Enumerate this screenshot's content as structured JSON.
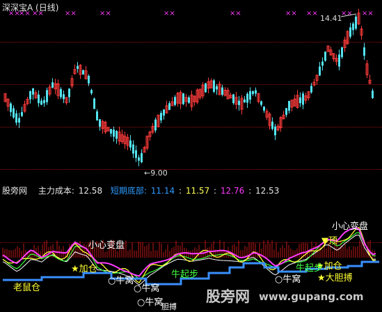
{
  "header": {
    "title": "深深宝A",
    "period": "(日线)"
  },
  "price_annotations": {
    "high": "14.41",
    "low": "9.00"
  },
  "indicator": {
    "name": "股旁网",
    "main_cost_label": "主力成本:",
    "main_cost_value": "12.58",
    "short_bottom_label": "短期底部:",
    "v1": "11.14",
    "v2": "11.57",
    "v3": "12.76",
    "v4": "12.53"
  },
  "signals": {
    "careful_change": "小心变盘",
    "careful_change_2": "小心变盘",
    "add_position": "加仓",
    "add_position_2": "加仓",
    "top": "顶",
    "bold_buy": "大胆搏",
    "old_mouse": "老鼠仓",
    "cattle_nest_1": "牛窝",
    "cattle_nest_2": "牛窝",
    "cattle_nest_3": "牛窝",
    "cattle_nest_4": "牛窝",
    "takeoff_1": "牛起步",
    "takeoff_2": "牛起步",
    "bold_buy_partial": "胆搏"
  },
  "watermark": {
    "cn": "股旁网",
    "url": "www.gupang.com"
  },
  "colors": {
    "up": "#ff3b3b",
    "down": "#54e3f0",
    "magenta": "#ff3bff",
    "blue": "#3a8fff",
    "yellow": "#ffff33",
    "white": "#ffffff"
  }
}
